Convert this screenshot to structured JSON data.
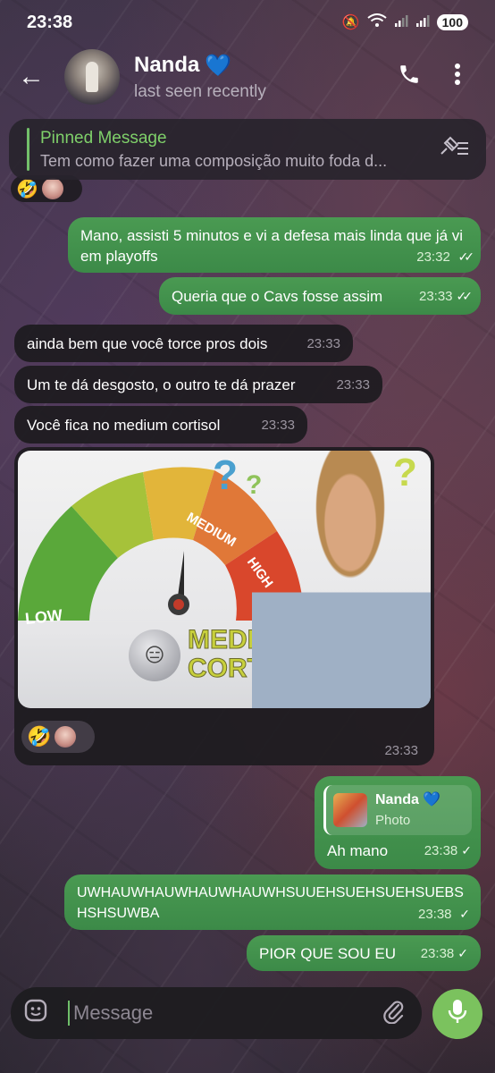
{
  "status_bar": {
    "time": "23:38",
    "icons": [
      "mute-icon",
      "wifi-icon",
      "signal-icon",
      "signal-icon"
    ],
    "battery": "100"
  },
  "header": {
    "name": "Nanda",
    "name_emoji": "💙",
    "status": "last seen recently"
  },
  "pinned": {
    "title": "Pinned Message",
    "text": "Tem como fazer uma composição muito foda d..."
  },
  "reactions_top": [
    "🤣"
  ],
  "messages": [
    {
      "direction": "out",
      "text": "Mano, assisti 5 minutos e vi a defesa mais linda que já vi em playoffs",
      "time": "23:32",
      "read": true
    },
    {
      "direction": "out",
      "text": "Queria que o Cavs fosse assim",
      "time": "23:33",
      "read": true
    },
    {
      "direction": "in",
      "text": "ainda bem que você torce pros dois",
      "time": "23:33"
    },
    {
      "direction": "in",
      "text": "Um te dá desgosto, o outro te dá prazer",
      "time": "23:33"
    },
    {
      "direction": "in",
      "text": "Você fica no medium cortisol",
      "time": "23:33"
    }
  ],
  "image_message": {
    "meme_labels": {
      "low": "LOW",
      "medium": "MEDIUM",
      "high": "HIGH",
      "caption_line1": "MEDIUM",
      "caption_line2": "CORTISOL"
    },
    "reaction": "🤣",
    "time": "23:33"
  },
  "reply_message": {
    "quote_name": "Nanda 💙",
    "quote_type": "Photo",
    "text": "Ah mano",
    "time": "23:38"
  },
  "later_messages": [
    {
      "direction": "out",
      "text": "UWHAUWHAUWHAUWHAUWHSUUEHSUEHSUEHSUEBSHSHSUWBA",
      "time": "23:38"
    },
    {
      "direction": "out",
      "text": "PIOR QUE SOU EU",
      "time": "23:38"
    }
  ],
  "input": {
    "placeholder": "Message"
  },
  "colors": {
    "accent_green": "#7bc25e",
    "outgoing_bubble": "#3f8f4c",
    "incoming_bubble": "#1e1c20",
    "pinned_title": "#7fd06a"
  }
}
